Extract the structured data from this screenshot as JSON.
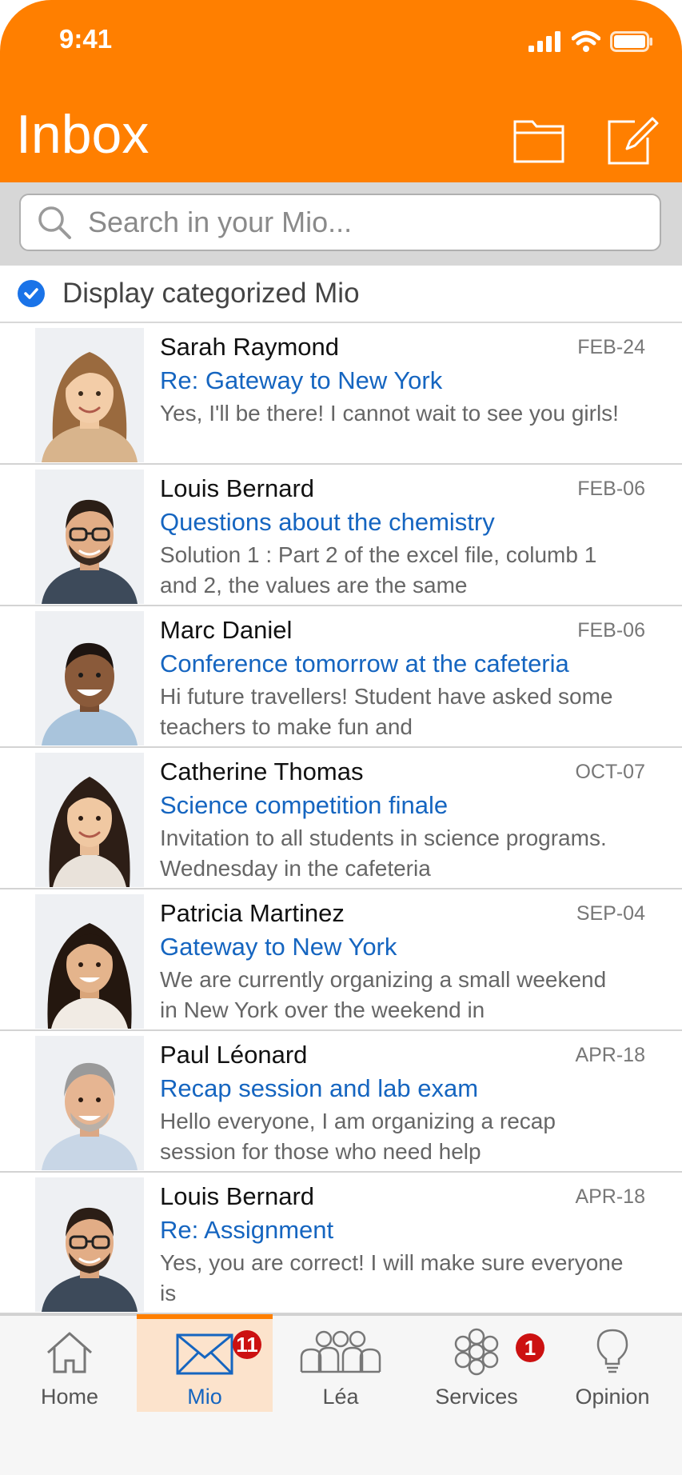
{
  "status_bar": {
    "time": "9:41"
  },
  "header": {
    "title": "Inbox",
    "folder_icon": "folder-icon",
    "compose_icon": "compose-icon",
    "background": "#FF7F00"
  },
  "search": {
    "placeholder": "Search in your Mio...",
    "value": ""
  },
  "filter": {
    "label": "Display categorized Mio",
    "checked": true
  },
  "messages": [
    {
      "sender": "Sarah Raymond",
      "date": "FEB-24",
      "subject": "Re: Gateway to New York",
      "preview": "Yes, I'll be there! I cannot wait to see you girls!"
    },
    {
      "sender": "Louis Bernard",
      "date": "FEB-06",
      "subject": "Questions about the chemistry",
      "preview": "Solution 1 : Part 2 of the excel file, columb 1 and 2, the values are the same"
    },
    {
      "sender": "Marc Daniel",
      "date": "FEB-06",
      "subject": "Conference tomorrow at the cafeteria",
      "preview": "Hi future travellers! Student have asked some teachers to make fun and"
    },
    {
      "sender": "Catherine Thomas",
      "date": "OCT-07",
      "subject": "Science competition finale",
      "preview": "Invitation to all students in science programs. Wednesday in the cafeteria"
    },
    {
      "sender": "Patricia Martinez",
      "date": "SEP-04",
      "subject": "Gateway to New York",
      "preview": "We are currently organizing a small weekend in New York over the weekend in"
    },
    {
      "sender": "Paul Léonard",
      "date": "APR-18",
      "subject": "Recap session and lab exam",
      "preview": "Hello everyone, I am organizing a recap session for those who need help"
    },
    {
      "sender": "Louis Bernard",
      "date": "APR-18",
      "subject": "Re: Assignment",
      "preview": "Yes, you are correct! I will make sure everyone is"
    }
  ],
  "tabs": [
    {
      "label": "Home",
      "icon": "home-icon"
    },
    {
      "label": "Mio",
      "icon": "envelope-icon",
      "badge": "11",
      "active": true
    },
    {
      "label": "Léa",
      "icon": "people-icon"
    },
    {
      "label": "Services",
      "icon": "flower-icon",
      "badge": "1"
    },
    {
      "label": "Opinion",
      "icon": "lightbulb-icon"
    }
  ],
  "colors": {
    "accent": "#FF7F00",
    "link": "#1565C0",
    "badge": "#CC1111",
    "check": "#1A73E8"
  }
}
